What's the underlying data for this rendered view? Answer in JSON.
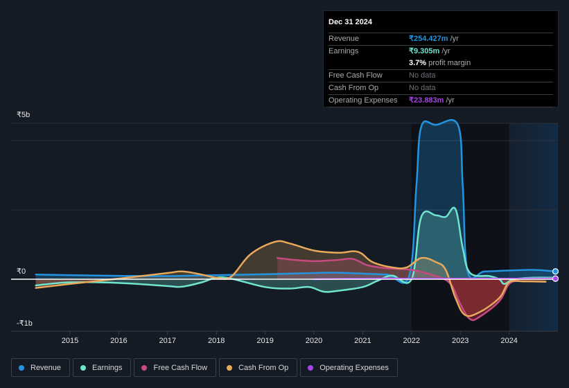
{
  "tooltip": {
    "date": "Dec 31 2024",
    "rows": [
      {
        "label": "Revenue",
        "value": "₹254.427m",
        "unit": " /yr",
        "color": "#2394df"
      },
      {
        "label": "Earnings",
        "value": "₹9.305m",
        "unit": " /yr",
        "color": "#70e4cf"
      },
      {
        "label": "",
        "value": "3.7%",
        "unit": " profit margin",
        "color": "#ffffff"
      },
      {
        "label": "Free Cash Flow",
        "value": "No data",
        "unit": "",
        "color": "#6d7176"
      },
      {
        "label": "Cash From Op",
        "value": "No data",
        "unit": "",
        "color": "#6d7176"
      },
      {
        "label": "Operating Expenses",
        "value": "₹23.883m",
        "unit": " /yr",
        "color": "#a545e8"
      }
    ]
  },
  "chart_data": {
    "type": "area",
    "title": "",
    "xlabel": "",
    "ylabel": "",
    "y_tick_labels": [
      "₹5b",
      "₹0",
      "-₹1b"
    ],
    "x_tick_labels": [
      "2015",
      "2016",
      "2017",
      "2018",
      "2019",
      "2020",
      "2021",
      "2022",
      "2023",
      "2024"
    ],
    "x_ticks": [
      2015,
      2016,
      2017,
      2018,
      2019,
      2020,
      2021,
      2022,
      2023,
      2024
    ],
    "xlim": [
      2013.8,
      2025.0
    ],
    "ylim": [
      -1.67,
      5.0
    ],
    "unit": "₹b",
    "forecast_shade_start": 2024.0,
    "legend_position": "bottom-left",
    "series": [
      {
        "name": "Revenue",
        "color": "#2394df",
        "points": [
          [
            2014.3,
            0.15
          ],
          [
            2015,
            0.13
          ],
          [
            2016,
            0.11
          ],
          [
            2017,
            0.1
          ],
          [
            2018,
            0.13
          ],
          [
            2019,
            0.16
          ],
          [
            2020,
            0.2
          ],
          [
            2020.5,
            0.21
          ],
          [
            2021,
            0.18
          ],
          [
            2021.5,
            0.15
          ],
          [
            2021.95,
            0.1
          ],
          [
            2022.1,
            3.0
          ],
          [
            2022.2,
            4.9
          ],
          [
            2022.5,
            4.95
          ],
          [
            2022.95,
            4.95
          ],
          [
            2023.05,
            3.0
          ],
          [
            2023.15,
            0.25
          ],
          [
            2023.5,
            0.25
          ],
          [
            2024,
            0.28
          ],
          [
            2024.5,
            0.3
          ],
          [
            2024.95,
            0.25
          ]
        ]
      },
      {
        "name": "Earnings",
        "color": "#70e4cf",
        "points": [
          [
            2014.3,
            -0.2
          ],
          [
            2015,
            -0.1
          ],
          [
            2016,
            -0.12
          ],
          [
            2017,
            -0.22
          ],
          [
            2017.3,
            -0.24
          ],
          [
            2017.7,
            -0.1
          ],
          [
            2018,
            0.05
          ],
          [
            2018.3,
            0.02
          ],
          [
            2019,
            -0.25
          ],
          [
            2019.5,
            -0.3
          ],
          [
            2019.9,
            -0.25
          ],
          [
            2020.2,
            -0.4
          ],
          [
            2020.5,
            -0.37
          ],
          [
            2021,
            -0.25
          ],
          [
            2021.3,
            -0.05
          ],
          [
            2021.6,
            0.12
          ],
          [
            2022,
            0.0
          ],
          [
            2022.2,
            2.0
          ],
          [
            2022.5,
            2.05
          ],
          [
            2022.7,
            2.0
          ],
          [
            2022.9,
            2.25
          ],
          [
            2023.05,
            1.0
          ],
          [
            2023.2,
            0.2
          ],
          [
            2023.6,
            0.1
          ],
          [
            2023.8,
            0.0
          ],
          [
            2023.9,
            -0.15
          ],
          [
            2024.1,
            0.0
          ],
          [
            2024.5,
            0.05
          ],
          [
            2024.95,
            0.05
          ]
        ]
      },
      {
        "name": "Free Cash Flow",
        "color": "#c94a80",
        "points": [
          [
            2019.25,
            0.68
          ],
          [
            2019.6,
            0.62
          ],
          [
            2020,
            0.58
          ],
          [
            2020.5,
            0.62
          ],
          [
            2020.8,
            0.65
          ],
          [
            2021.1,
            0.45
          ],
          [
            2021.5,
            0.35
          ],
          [
            2022,
            0.3
          ],
          [
            2022.5,
            0.1
          ],
          [
            2022.8,
            -0.15
          ],
          [
            2023,
            -0.8
          ],
          [
            2023.2,
            -1.28
          ],
          [
            2023.4,
            -1.2
          ],
          [
            2023.8,
            -0.7
          ],
          [
            2024,
            -0.15
          ],
          [
            2024.2,
            -0.05
          ]
        ]
      },
      {
        "name": "Cash From Op",
        "color": "#e8a95c",
        "points": [
          [
            2014.3,
            -0.28
          ],
          [
            2015,
            -0.15
          ],
          [
            2016,
            0.02
          ],
          [
            2017,
            0.2
          ],
          [
            2017.3,
            0.25
          ],
          [
            2017.7,
            0.15
          ],
          [
            2018,
            0.05
          ],
          [
            2018.3,
            0.08
          ],
          [
            2018.7,
            0.8
          ],
          [
            2019.2,
            1.2
          ],
          [
            2019.5,
            1.15
          ],
          [
            2020,
            0.92
          ],
          [
            2020.5,
            0.85
          ],
          [
            2020.9,
            0.88
          ],
          [
            2021.2,
            0.55
          ],
          [
            2021.6,
            0.38
          ],
          [
            2021.9,
            0.38
          ],
          [
            2022.2,
            0.68
          ],
          [
            2022.5,
            0.55
          ],
          [
            2022.7,
            0.3
          ],
          [
            2022.9,
            -0.6
          ],
          [
            2023.1,
            -1.15
          ],
          [
            2023.4,
            -1.05
          ],
          [
            2023.8,
            -0.6
          ],
          [
            2024,
            -0.1
          ],
          [
            2024.3,
            -0.07
          ],
          [
            2024.75,
            -0.08
          ]
        ]
      },
      {
        "name": "Operating Expenses",
        "color": "#a545e8",
        "points": [
          [
            2020.0,
            0.0
          ],
          [
            2021,
            0.02
          ],
          [
            2022,
            0.02
          ],
          [
            2023,
            0.02
          ],
          [
            2024,
            0.02
          ],
          [
            2024.95,
            0.02
          ]
        ]
      }
    ]
  },
  "legend": [
    {
      "label": "Revenue",
      "color": "#2394df"
    },
    {
      "label": "Earnings",
      "color": "#70e4cf"
    },
    {
      "label": "Free Cash Flow",
      "color": "#c94a80"
    },
    {
      "label": "Cash From Op",
      "color": "#e8a95c"
    },
    {
      "label": "Operating Expenses",
      "color": "#a545e8"
    }
  ]
}
